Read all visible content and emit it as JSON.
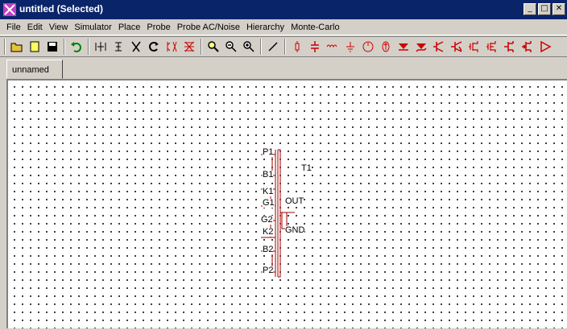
{
  "window": {
    "title": "untitled (Selected)"
  },
  "window_controls": {
    "minimize": "_",
    "maximize": "□",
    "close": "✕"
  },
  "menu": [
    {
      "label": "File"
    },
    {
      "label": "Edit"
    },
    {
      "label": "View"
    },
    {
      "label": "Simulator"
    },
    {
      "label": "Place"
    },
    {
      "label": "Probe"
    },
    {
      "label": "Probe AC/Noise"
    },
    {
      "label": "Hierarchy"
    },
    {
      "label": "Monte-Carlo"
    }
  ],
  "toolbar": {
    "icons": [
      "open-folder-icon",
      "new-file-icon",
      "save-icon",
      "undo-icon",
      "flip-horizontal-icon",
      "flip-vertical-icon",
      "cut-icon",
      "rotate-icon",
      "mirror-icon",
      "delete-wire-icon",
      "zoom-in-icon",
      "zoom-out-icon",
      "zoom-fit-icon",
      "wire-pen-icon",
      "resistor-icon",
      "capacitor-icon",
      "inductor-icon",
      "ground-icon",
      "voltage-source-icon",
      "current-source-icon",
      "diode-icon",
      "zener-icon",
      "npn-transistor-icon",
      "pnp-transistor-icon",
      "nmos-icon",
      "pmos-icon",
      "njfet-icon",
      "pjfet-icon",
      "opamp-icon"
    ],
    "accent_color": "#cc0000"
  },
  "tabs": [
    {
      "label": "unnamed"
    }
  ],
  "schematic": {
    "component_label": "T1",
    "pins_left": [
      "P1",
      "B1",
      "K1",
      "G1",
      "G2",
      "K2",
      "B2",
      "P2"
    ],
    "pins_right": [
      "OUT",
      "GND"
    ],
    "color": "#a00000"
  }
}
